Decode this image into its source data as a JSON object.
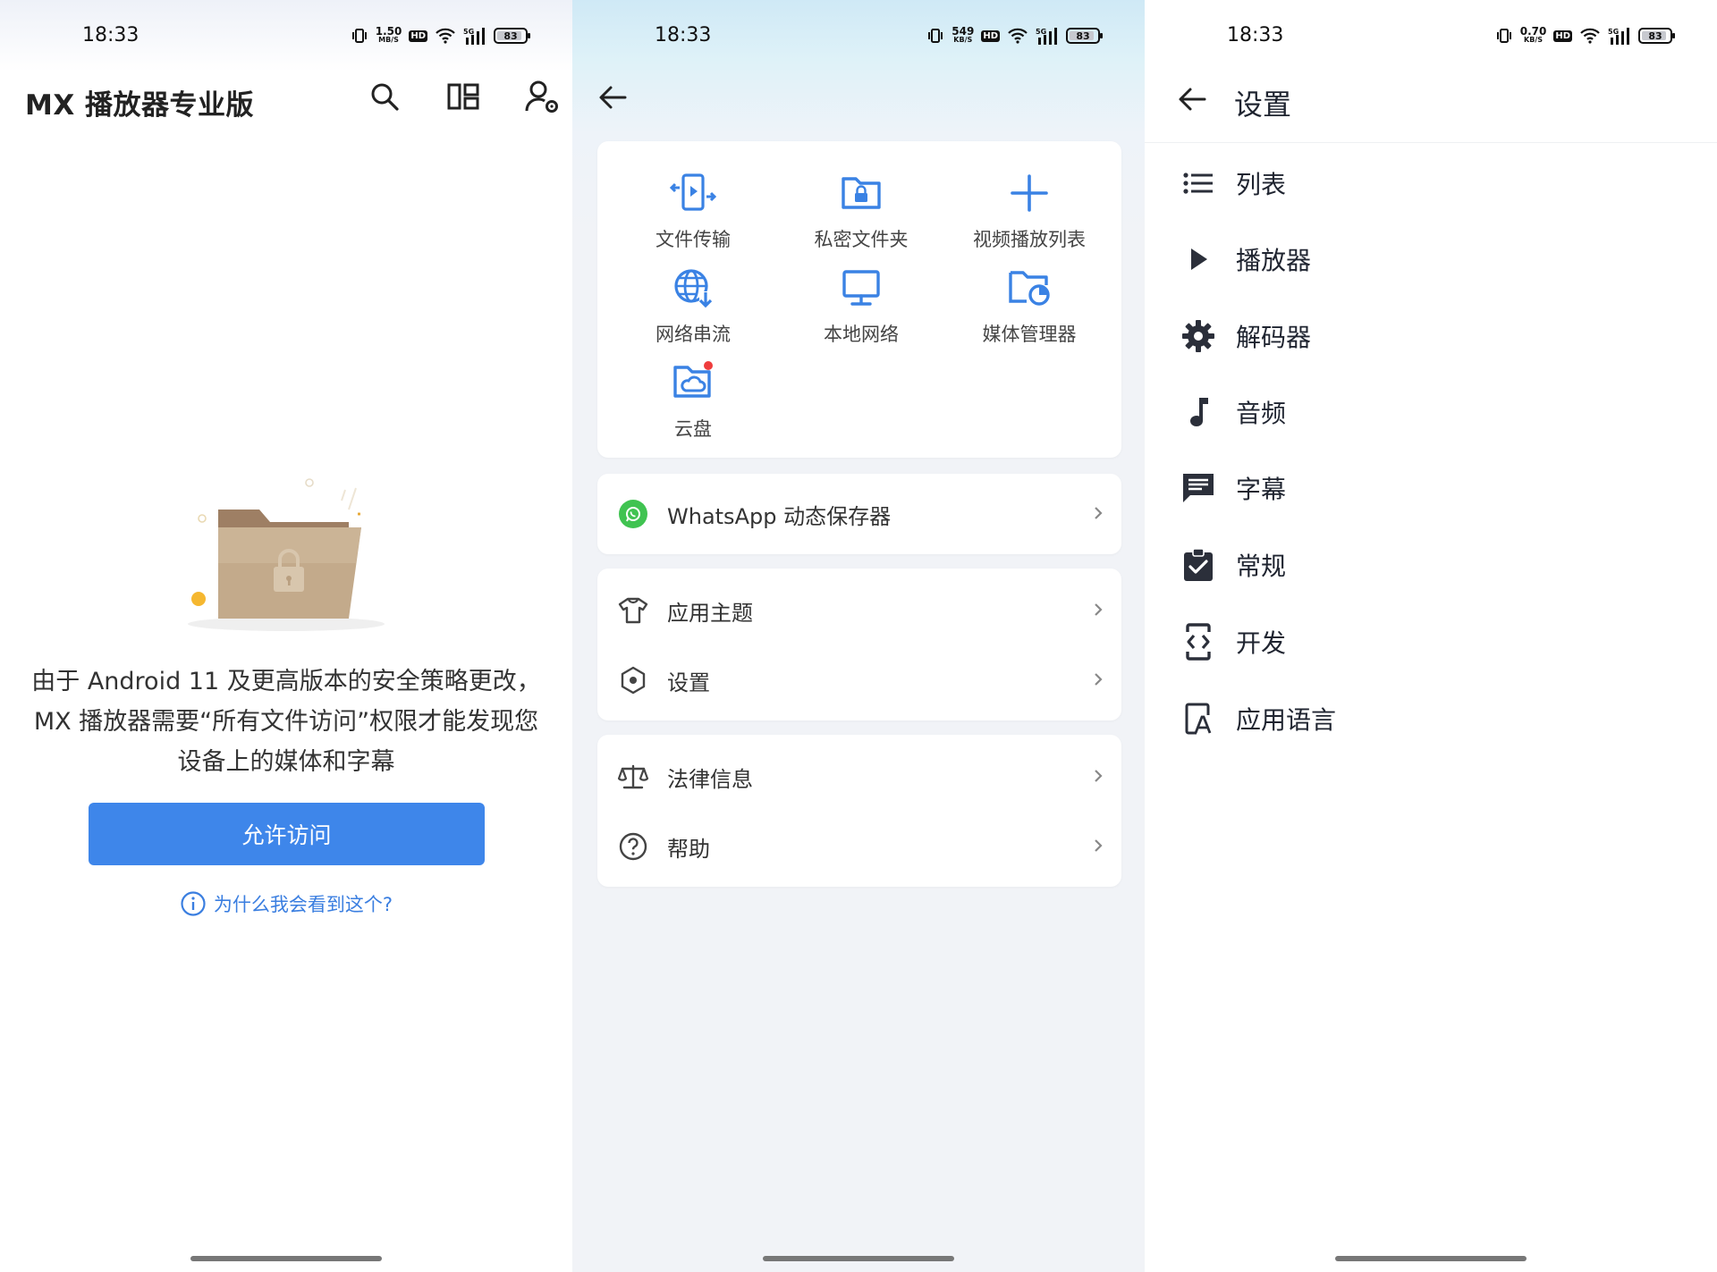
{
  "status": {
    "time": "18:33",
    "screen1_speed": "1.50",
    "screen1_speed_unit": "MB/S",
    "screen2_speed": "549",
    "screen2_speed_unit": "KB/S",
    "screen3_speed": "0.70",
    "screen3_speed_unit": "KB/S",
    "hd": "HD",
    "battery": "83"
  },
  "screen1": {
    "title": "MX 播放器专业版",
    "permission_text": "由于 Android 11 及更高版本的安全策略更改，MX 播放器需要“所有文件访问”权限才能发现您设备上的媒体和字幕",
    "allow_button": "允许访问",
    "why_link": "为什么我会看到这个?"
  },
  "screen2": {
    "grid": [
      {
        "label": "文件传输",
        "icon": "file-transfer-icon"
      },
      {
        "label": "私密文件夹",
        "icon": "private-folder-icon"
      },
      {
        "label": "视频播放列表",
        "icon": "add-playlist-icon"
      },
      {
        "label": "网络串流",
        "icon": "network-stream-icon"
      },
      {
        "label": "本地网络",
        "icon": "local-network-icon"
      },
      {
        "label": "媒体管理器",
        "icon": "media-manager-icon"
      },
      {
        "label": "云盘",
        "icon": "cloud-drive-icon"
      }
    ],
    "whatsapp": "WhatsApp 动态保存器",
    "theme": "应用主题",
    "settings": "设置",
    "legal": "法律信息",
    "help": "帮助"
  },
  "screen3": {
    "title": "设置",
    "items": [
      {
        "label": "列表",
        "icon": "list-icon"
      },
      {
        "label": "播放器",
        "icon": "play-icon"
      },
      {
        "label": "解码器",
        "icon": "gear-icon"
      },
      {
        "label": "音频",
        "icon": "music-note-icon"
      },
      {
        "label": "字幕",
        "icon": "subtitle-icon"
      },
      {
        "label": "常规",
        "icon": "clipboard-check-icon"
      },
      {
        "label": "开发",
        "icon": "developer-icon"
      },
      {
        "label": "应用语言",
        "icon": "language-icon"
      }
    ]
  },
  "colors": {
    "accent": "#3e86ea",
    "icon_blue": "#3a82e4",
    "whatsapp_green": "#40c351",
    "badge_red": "#ef3d3d"
  }
}
